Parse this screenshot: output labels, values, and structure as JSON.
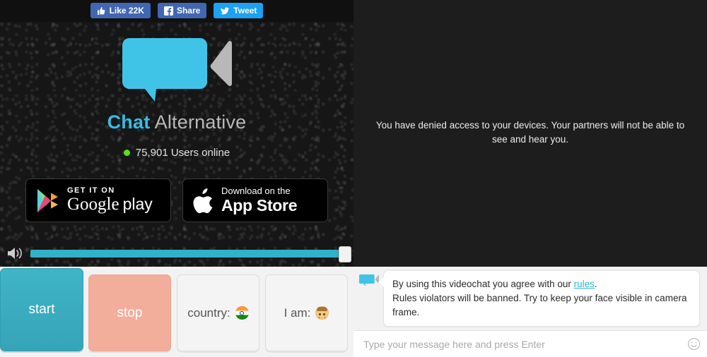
{
  "social": {
    "like": {
      "label": "Like 22K",
      "icon": "thumbs-up-icon",
      "color": "#4267b2"
    },
    "share": {
      "label": "Share",
      "icon": "facebook-icon",
      "color": "#4267b2"
    },
    "tweet": {
      "label": "Tweet",
      "icon": "twitter-bird-icon",
      "color": "#1da1f2"
    }
  },
  "brand": {
    "name_first": "Chat",
    "name_second": " Alternative",
    "first_color": "#35bde4",
    "second_color": "#b9b9b9",
    "logo_icon": "video-chat-bubble-icon",
    "logo_bubble_color": "#3fc4e8",
    "logo_lens_color": "#b8b8b8"
  },
  "online": {
    "text": "75,901 Users online",
    "dot_color": "#5ede1b",
    "status_icon": "online-dot-icon"
  },
  "stores": {
    "google": {
      "small": "GET IT ON",
      "big": "Google",
      "big_suffix": "play",
      "icon": "google-play-triangle-icon"
    },
    "apple": {
      "small": "Download on the",
      "big": "App Store",
      "icon": "apple-logo-icon"
    }
  },
  "volume": {
    "icon": "speaker-volume-icon",
    "level": 100,
    "track_color": "#32b2c9"
  },
  "video": {
    "denied_message": "You have denied access to your devices. Your partners will not be able to see and hear you."
  },
  "controls": {
    "start": {
      "label": "start",
      "color": "#3fb5c6"
    },
    "stop": {
      "label": "stop",
      "color": "#f3ad9b"
    },
    "country": {
      "label": "country:",
      "emoji": "india-flag-emoji"
    },
    "gender": {
      "label": "I am:",
      "emoji": "man-face-emoji"
    }
  },
  "chat": {
    "avatar_icon": "video-chat-bubble-icon",
    "system_message_part1": "By using this videochat you agree with our ",
    "system_message_link": "rules",
    "system_message_part2": ".",
    "system_message_line2": "Rules violators will be banned. Try to keep your face visible in camera frame.",
    "input_placeholder": "Type your message here and press Enter",
    "input_value": "",
    "smiley_icon": "smiley-face-icon"
  }
}
